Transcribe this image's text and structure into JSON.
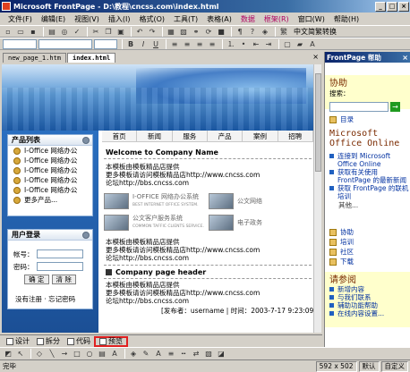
{
  "window": {
    "title": "Microsoft FrontPage - D:\\教程\\cncss.com\\index.html"
  },
  "menu": [
    "文件(F)",
    "编辑(E)",
    "视图(V)",
    "插入(I)",
    "格式(O)",
    "工具(T)",
    "表格(A)",
    "数据",
    "框架(R)",
    "窗口(W)",
    "帮助(H)"
  ],
  "toolbar": {
    "font_size_label": "中文简繁转换"
  },
  "tabs": [
    "new_page_1.htm",
    "index.html"
  ],
  "page": {
    "nav": [
      "首页",
      "新闻",
      "服务",
      "产品",
      "案例",
      "招聘"
    ],
    "products_title": "产品列表",
    "products": [
      "I-Office 网络办公",
      "I-Office 网络办公",
      "I-Office 网络办公",
      "I-Office 网络办公",
      "I-Office 网络办公",
      "更多产品..."
    ],
    "login": {
      "title": "用户登录",
      "user_label": "帐号：",
      "pass_label": "密码：",
      "ok": "确  定",
      "reset": "清  除",
      "links": "没有注册 · 忘记密码"
    },
    "welcome": "Welcome to Company Name",
    "intro": [
      "本模板由模板精品店提供",
      "更多模板请访问模板精品店http://www.cncss.com",
      "论坛http://bbs.cncss.com"
    ],
    "thumbs": [
      {
        "cap": "I-OFFICE 网络办公系统",
        "sub": "BEST INTERNET OFFICE SYSTEM."
      },
      {
        "cap": "公文网络",
        "sub": ""
      },
      {
        "cap": "公文客户服务系统",
        "sub": "COMMON TAFFIC CLIENTS SERVICE."
      },
      {
        "cap": "电子政务",
        "sub": ""
      }
    ],
    "intro2": [
      "本模板由模板精品店提供",
      "更多模板请访问模板精品店http://www.cncss.com",
      "论坛http://bbs.cncss.com"
    ],
    "header2": "Company page header",
    "intro3": [
      "本模板由模板精品店提供",
      "更多模板请访问模板精品店http://www.cncss.com",
      "论坛http://bbs.cncss.com"
    ],
    "footer": "[发布者：username | 时间：2003-7-17 9:23:09 ]"
  },
  "viewbar": {
    "design": "设计",
    "split": "拆分",
    "code": "代码",
    "preview": "预览"
  },
  "taskpane": {
    "header": "FrontPage 帮助",
    "section": "协助",
    "search_label": "搜索：",
    "toc": "目录",
    "online_title": "Microsoft Office Online",
    "online_links": [
      "连接到 Microsoft Office Online",
      "获取有关使用 FrontPage 的最新新闻",
      "获取 FrontPage 的联机培训"
    ],
    "other": "其他...",
    "links": [
      "协助",
      "培训",
      "社区",
      "下载"
    ],
    "see_title": "请参阅",
    "see_links": [
      "新增内容",
      "与我们联系",
      "辅助功能帮助",
      "在线内容设置..."
    ]
  },
  "status": {
    "left": "完毕",
    "size": "592 x 502",
    "mode": "默认",
    "custom": "自定义"
  }
}
